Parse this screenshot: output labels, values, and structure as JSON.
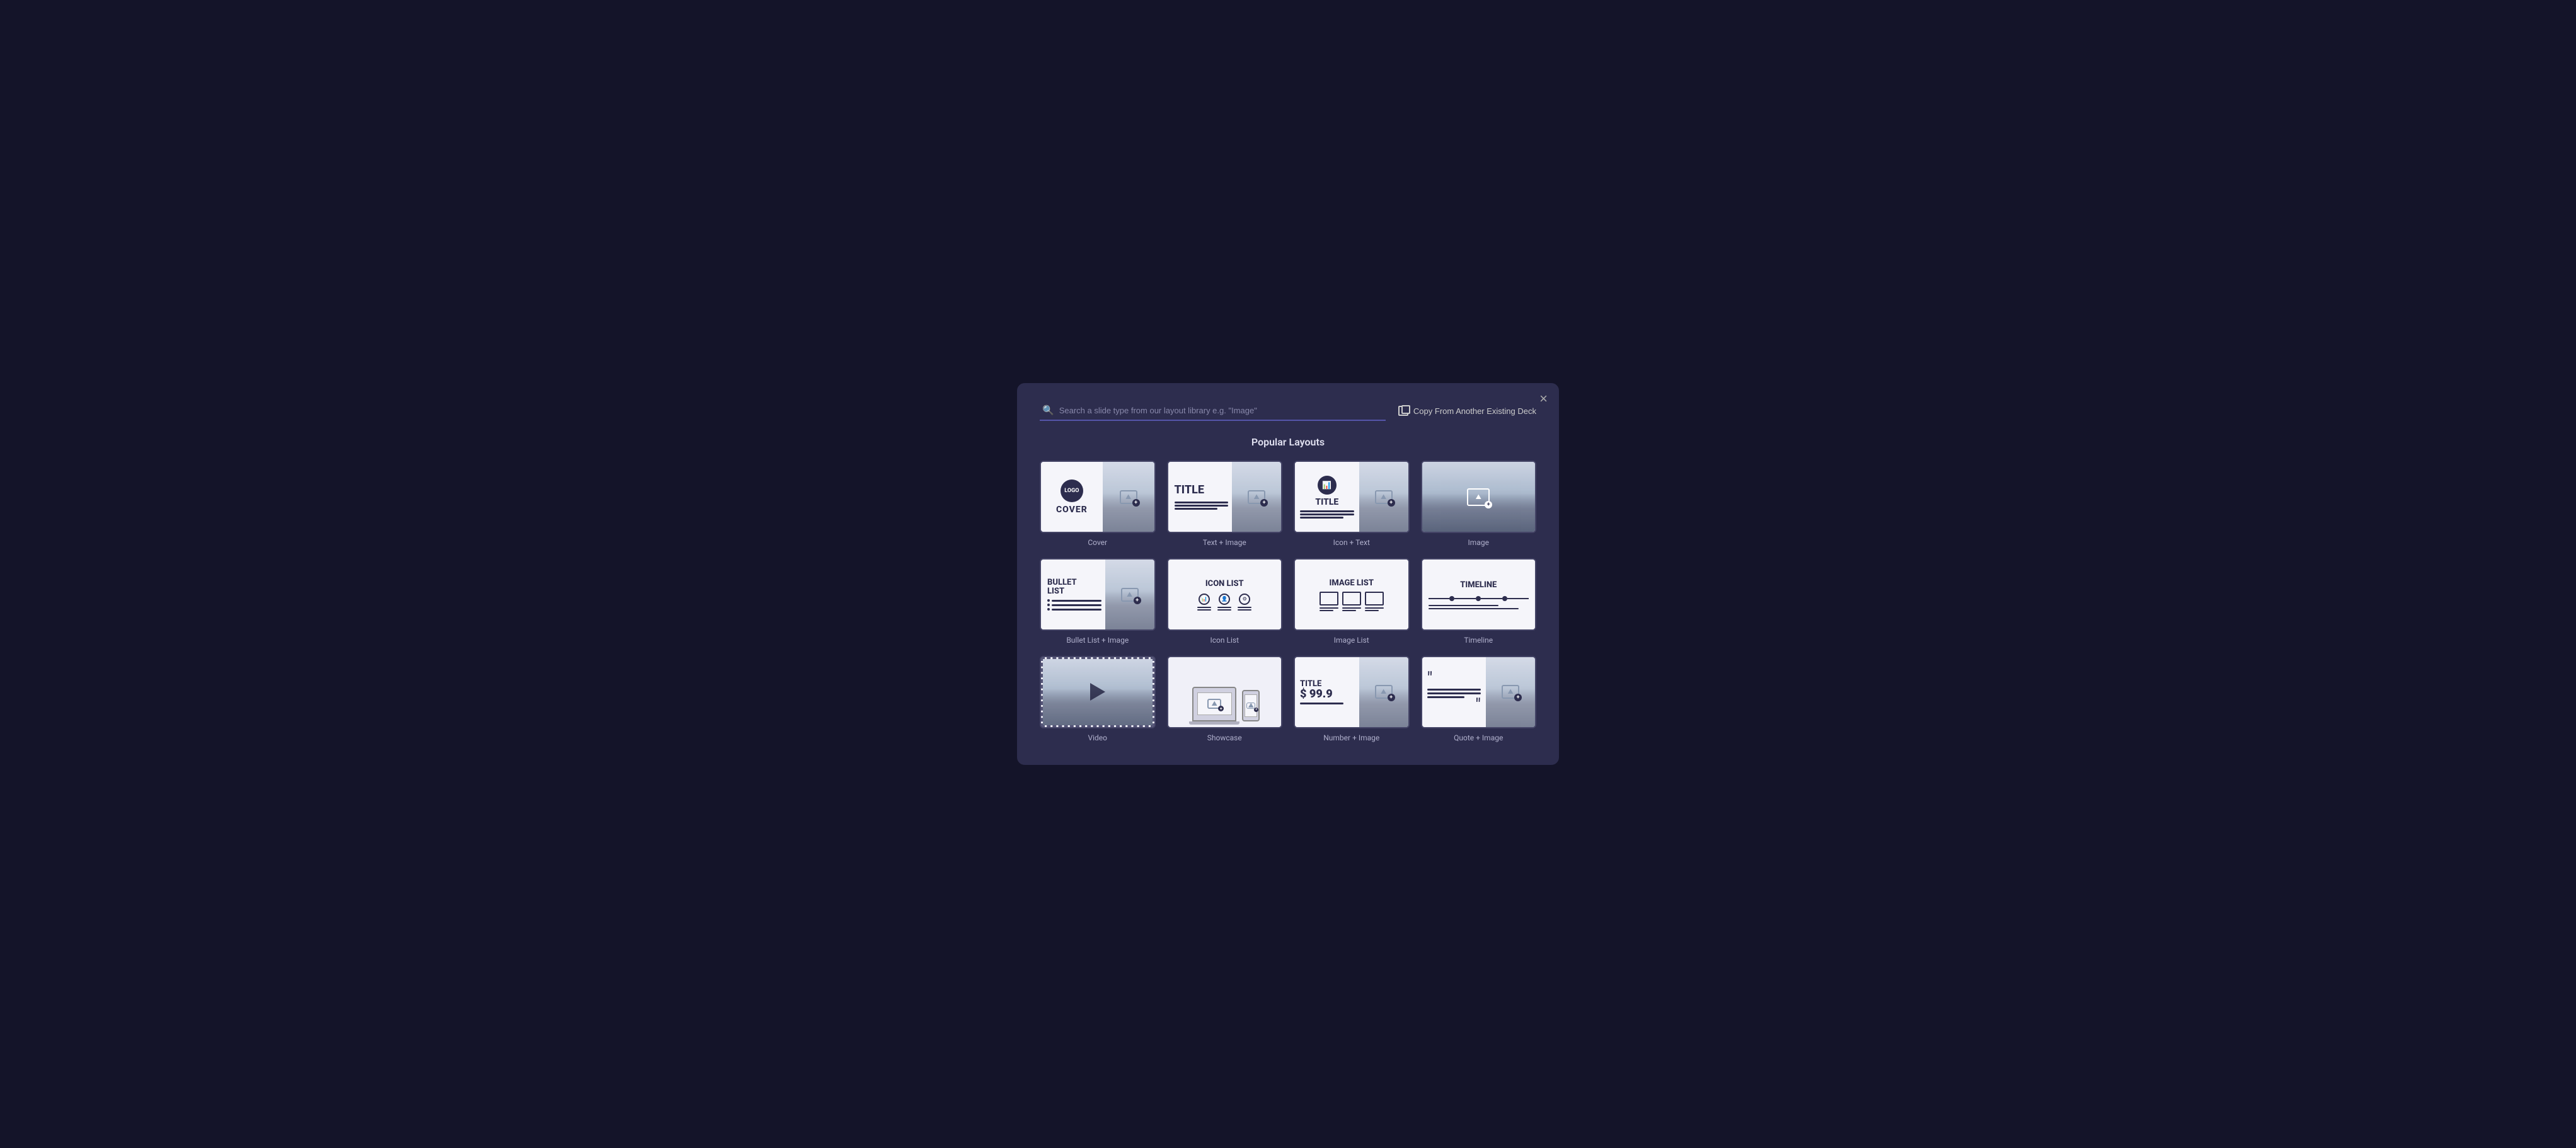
{
  "modal": {
    "title": "Popular Layouts",
    "search": {
      "placeholder": "Search a slide type from our layout library e.g. \"Image\""
    },
    "copy_button": "Copy From Another Existing Deck",
    "close_label": "×",
    "layouts": [
      {
        "id": "cover",
        "label": "Cover",
        "type": "cover"
      },
      {
        "id": "text-image",
        "label": "Text + Image",
        "type": "text-image"
      },
      {
        "id": "icon-text",
        "label": "Icon + Text",
        "type": "icon-text"
      },
      {
        "id": "image",
        "label": "Image",
        "type": "image"
      },
      {
        "id": "bullet-list",
        "label": "Bullet List + Image",
        "type": "bullet-list"
      },
      {
        "id": "icon-list",
        "label": "Icon List",
        "type": "icon-list"
      },
      {
        "id": "image-list",
        "label": "Image List",
        "type": "image-list"
      },
      {
        "id": "timeline",
        "label": "Timeline",
        "type": "timeline"
      },
      {
        "id": "video",
        "label": "Video",
        "type": "video"
      },
      {
        "id": "showcase",
        "label": "Showcase",
        "type": "showcase"
      },
      {
        "id": "number-image",
        "label": "Number + Image",
        "type": "number-image"
      },
      {
        "id": "quote-image",
        "label": "Quote + Image",
        "type": "quote-image"
      }
    ]
  }
}
